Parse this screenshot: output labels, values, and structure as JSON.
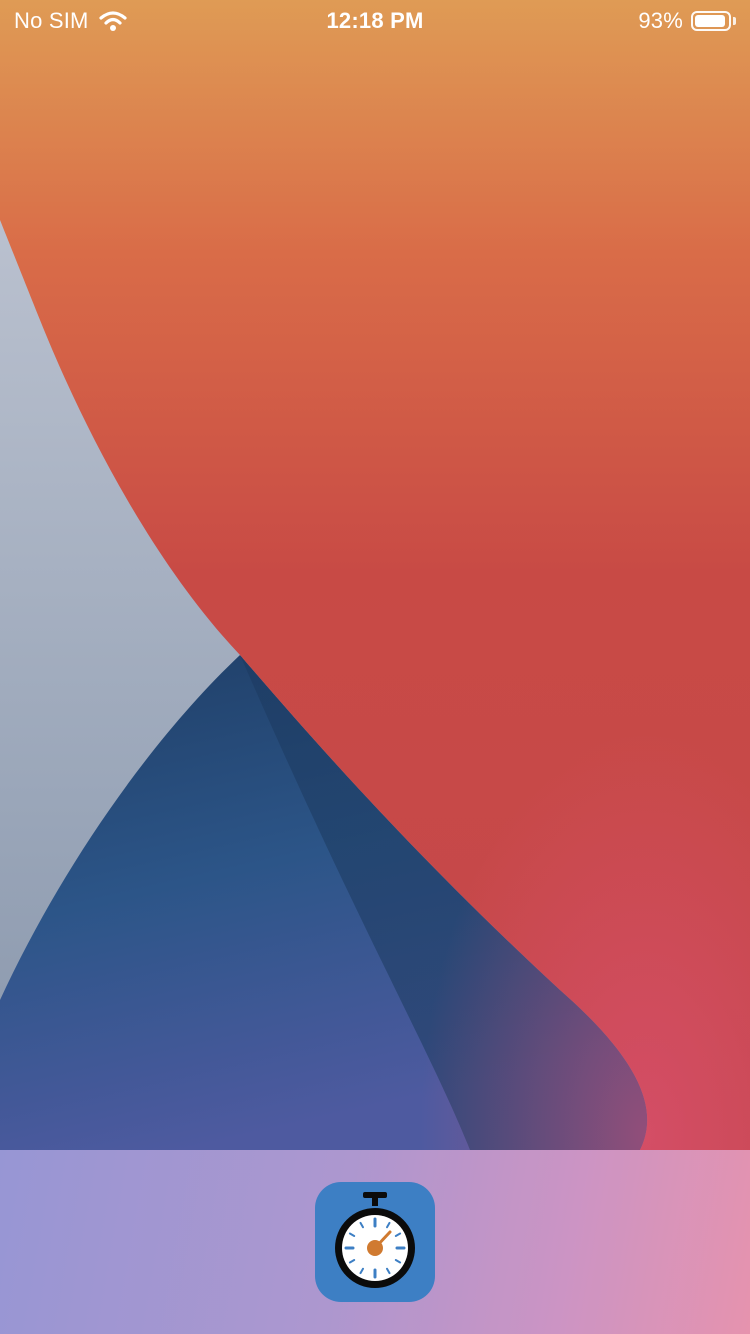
{
  "status_bar": {
    "carrier": "No SIM",
    "time": "12:18 PM",
    "battery_percent_label": "93%",
    "battery_level": 0.93,
    "wifi_icon": "wifi-icon",
    "battery_icon": "battery-icon"
  },
  "dock": {
    "apps": [
      {
        "icon": "stopwatch-icon",
        "tile_color": "#3d7fc4",
        "needle_color": "#d07a30",
        "tick_color": "#3d7fc4"
      }
    ]
  },
  "wallpaper": {
    "colors": {
      "orange_top": "#dd9a55",
      "red": "#c94a45",
      "navy": "#223f66",
      "slate": "#a7b0c3"
    }
  }
}
